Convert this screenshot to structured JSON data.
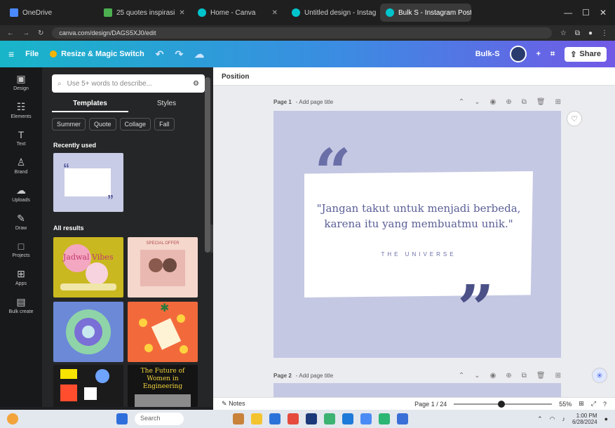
{
  "browser": {
    "tabs": [
      {
        "label": "OneDrive",
        "active": false
      },
      {
        "label": "25 quotes inspirasi",
        "active": false
      },
      {
        "label": "Home - Canva",
        "active": false
      },
      {
        "label": "Untitled design - Instag",
        "active": false
      },
      {
        "label": "Bulk S - Instagram Post",
        "active": true
      }
    ],
    "url": "canva.com/design/DAGS5XJ0/edit",
    "window_controls": [
      "—",
      "☐",
      "✕"
    ]
  },
  "header": {
    "menu_icon": "≡",
    "file_label": "File",
    "resize_label": "Resize & Magic Switch",
    "bulk_label": "Bulk-S",
    "share_label": "Share"
  },
  "rail": [
    {
      "name": "design",
      "icon": "▣",
      "label": "Design"
    },
    {
      "name": "elements",
      "icon": "☷",
      "label": "Elements"
    },
    {
      "name": "text",
      "icon": "T",
      "label": "Text"
    },
    {
      "name": "brand",
      "icon": "♙",
      "label": "Brand"
    },
    {
      "name": "uploads",
      "icon": "☁",
      "label": "Uploads"
    },
    {
      "name": "draw",
      "icon": "✎",
      "label": "Draw"
    },
    {
      "name": "projects",
      "icon": "□",
      "label": "Projects"
    },
    {
      "name": "apps",
      "icon": "⊞",
      "label": "Apps"
    },
    {
      "name": "bulk-create",
      "icon": "▤",
      "label": "Bulk create"
    }
  ],
  "panel": {
    "search_placeholder": "Use 5+ words to describe...",
    "tabs": [
      {
        "label": "Templates",
        "active": true
      },
      {
        "label": "Styles",
        "active": false
      }
    ],
    "chips": [
      "Summer",
      "Quote",
      "Collage",
      "Fall"
    ],
    "recently_used": "Recently used",
    "all_results": "All results",
    "thumbs": [
      {
        "bg": "#c9b81f",
        "text": "Jadwal Vibes"
      },
      {
        "bg": "#f5d7cc",
        "text": "SPECIAL OFFER"
      },
      {
        "bg": "#6c89d8",
        "text": ""
      },
      {
        "bg": "#f26a3c",
        "text": ""
      },
      {
        "bg": "#1b1b1b",
        "text": ""
      },
      {
        "bg": "#141414",
        "text": "The Future of Women in Engineering"
      }
    ]
  },
  "canvas": {
    "position_label": "Position",
    "page1_label": "Page 1",
    "page1_title_hint": " - Add page title",
    "page2_label": "Page 2",
    "page2_title_hint": " - Add page title",
    "quote_open": "“",
    "quote_close": "”",
    "quote_text": "\"Jangan takut untuk menjadi berbeda, karena itu yang membuatmu unik.\"",
    "author": "THE UNIVERSE",
    "colors": {
      "page": "#c5c8e3",
      "accent": "#5a5f96"
    }
  },
  "bottom": {
    "notes_label": "Notes",
    "page_indicator": "Page 1 / 24",
    "zoom": "55%",
    "zoom_fraction": 0.45
  },
  "taskbar": {
    "search_label": "Search",
    "time": "1:00 PM",
    "date": "6/28/2024"
  }
}
